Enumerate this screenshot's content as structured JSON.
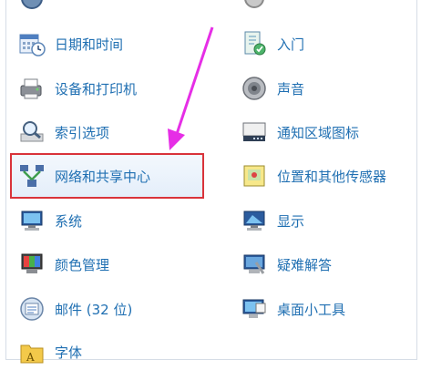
{
  "items": [
    {
      "key": "top-left-partial",
      "label": "",
      "icon": "partial-icon"
    },
    {
      "key": "top-right-partial",
      "label": "",
      "icon": "partial-icon"
    },
    {
      "key": "date-time",
      "label": "日期和时间",
      "icon": "calendar-clock-icon"
    },
    {
      "key": "getting-started",
      "label": "入门",
      "icon": "getting-started-icon"
    },
    {
      "key": "devices-printers",
      "label": "设备和打印机",
      "icon": "printer-icon"
    },
    {
      "key": "sound",
      "label": "声音",
      "icon": "speaker-icon"
    },
    {
      "key": "indexing-options",
      "label": "索引选项",
      "icon": "magnifier-icon"
    },
    {
      "key": "notification-icons",
      "label": "通知区域图标",
      "icon": "taskbar-icon"
    },
    {
      "key": "network-sharing",
      "label": "网络和共享中心",
      "icon": "network-icon"
    },
    {
      "key": "location-sensors",
      "label": "位置和其他传感器",
      "icon": "location-sensor-icon"
    },
    {
      "key": "system",
      "label": "系统",
      "icon": "computer-icon"
    },
    {
      "key": "display",
      "label": "显示",
      "icon": "monitor-icon"
    },
    {
      "key": "color-management",
      "label": "颜色管理",
      "icon": "color-management-icon"
    },
    {
      "key": "troubleshooting",
      "label": "疑难解答",
      "icon": "troubleshoot-icon"
    },
    {
      "key": "mail",
      "label": "邮件 (32 位)",
      "icon": "mail-icon"
    },
    {
      "key": "gadgets",
      "label": "桌面小工具",
      "icon": "gadgets-icon"
    },
    {
      "key": "fonts",
      "label": "字体",
      "icon": "font-folder-icon"
    }
  ],
  "colors": {
    "link": "#1f6fb2",
    "highlight_border": "#d9333a",
    "arrow": "#e62ee6"
  }
}
